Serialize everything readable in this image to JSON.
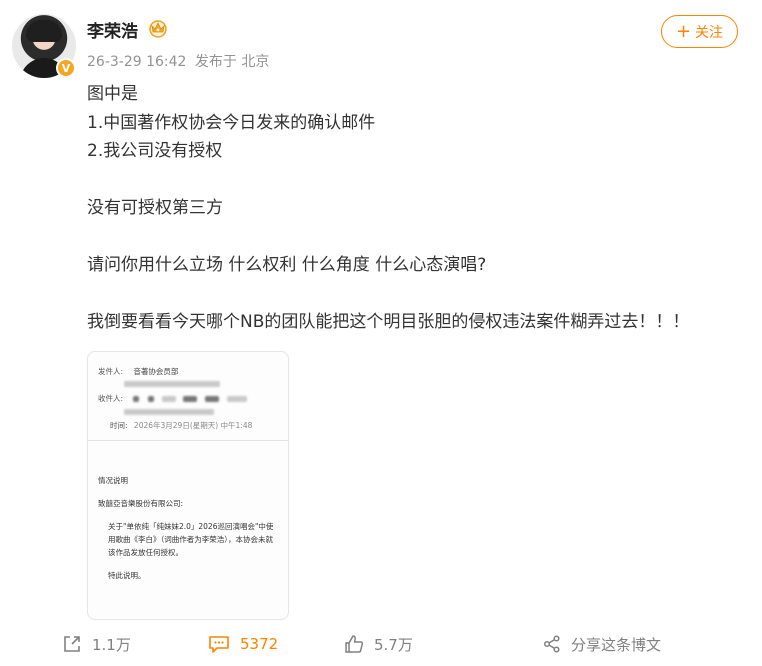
{
  "user": {
    "name": "李荣浩",
    "avatar_icon": "avatar-portrait",
    "verified_icon": "verified-v-badge",
    "member_icon": "member-crown-icon"
  },
  "meta": {
    "date": "26-3-29 16:42",
    "location": "发布于 北京"
  },
  "follow": {
    "icon": "plus-icon",
    "label": "关注"
  },
  "post": {
    "lines": [
      "图中是",
      "1.中国著作权协会今日发来的确认邮件",
      "2.我公司没有授权",
      "",
      "没有可授权第三方",
      "",
      "请问你用什么立场 什么权利 什么角度 什么心态演唱?",
      "",
      "我倒要看看今天哪个NB的团队能把这个明目张胆的侵权违法案件糊弄过去！！！"
    ]
  },
  "image": {
    "sender_label": "发件人:",
    "sender_value": "音著协会员部",
    "recipient_label": "收件人:",
    "time_label": "时间:",
    "time_value": "2026年3月29日(星期天) 中午1:48",
    "heading": "情况说明",
    "addressee": "致囍亞音樂股份有限公司:",
    "body": "关于\"单依纯「纯妹妹2.0」2026巡回演唱会\"中使用歌曲《李白》（词曲作者为李荣浩），本协会未就该作品发放任何授权。",
    "closing": "特此说明。"
  },
  "actions": {
    "share_count": "1.1万",
    "comment_count": "5372",
    "like_count": "5.7万",
    "forward_label": "分享这条博文"
  },
  "colors": {
    "accent": "#ff8200",
    "muted": "#939393",
    "text": "#333333"
  }
}
